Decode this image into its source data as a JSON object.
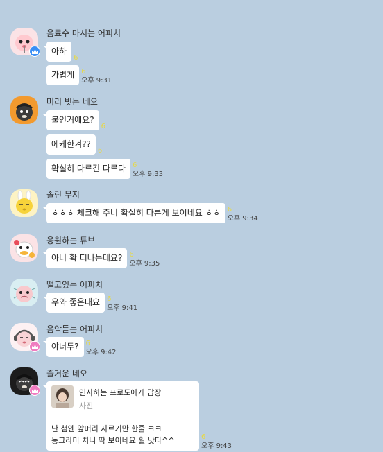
{
  "groups": [
    {
      "sender": "음료수 마시는 어피치",
      "avatar_icon": "apeach-drinking-avatar-icon",
      "badge": "blue-crown",
      "messages": [
        {
          "text": "아하",
          "unread": "6",
          "time": ""
        },
        {
          "text": "가볍게",
          "unread": "6",
          "time": "오후 9:31"
        }
      ]
    },
    {
      "sender": "머리 빗는 네오",
      "avatar_icon": "neo-combing-avatar-icon",
      "badge": "",
      "messages": [
        {
          "text": "불인거에요?",
          "unread": "6",
          "time": ""
        },
        {
          "text": "에케한겨??",
          "unread": "6",
          "time": ""
        },
        {
          "text": "확실히 다르긴 다르다",
          "unread": "6",
          "time": "오후 9:33"
        }
      ]
    },
    {
      "sender": "졸린 무지",
      "avatar_icon": "muzi-sleepy-avatar-icon",
      "badge": "",
      "messages": [
        {
          "text": "ㅎㅎㅎ 체크해 주니 확실히 다른게 보이네요 ㅎㅎ",
          "unread": "6",
          "time": "오후 9:34"
        }
      ]
    },
    {
      "sender": "응원하는 튜브",
      "avatar_icon": "tube-cheering-avatar-icon",
      "badge": "",
      "messages": [
        {
          "text": "아니 확 티나는데요?",
          "unread": "6",
          "time": "오후 9:35"
        }
      ]
    },
    {
      "sender": "떨고있는 어피치",
      "avatar_icon": "apeach-shivering-avatar-icon",
      "badge": "",
      "messages": [
        {
          "text": "우와 좋은대요",
          "unread": "6",
          "time": "오후 9:41"
        }
      ]
    },
    {
      "sender": "음악듣는 어피치",
      "avatar_icon": "apeach-music-avatar-icon",
      "badge": "pink-crown",
      "messages": [
        {
          "text": "야너두?",
          "unread": "6",
          "time": "오후 9:42"
        }
      ]
    },
    {
      "sender": "즐거운 네오",
      "avatar_icon": "neo-happy-avatar-icon",
      "badge": "pink-crown",
      "reply": {
        "title": "인사하는 프로도에게 답장",
        "subtitle": "사진",
        "body": "난 첨엔 앞머리 자르기만 한줄 ㅋㅋ\n동그라미 치니 딱 보이네요 훨 낫다^^",
        "unread": "6",
        "time": "오후 9:43"
      }
    }
  ],
  "colors": {
    "background": "#bacee0",
    "bubble": "#ffffff",
    "unread": "#e6d84a",
    "blue_crown": "#3b8ff5",
    "pink_crown": "#f07cc0"
  }
}
